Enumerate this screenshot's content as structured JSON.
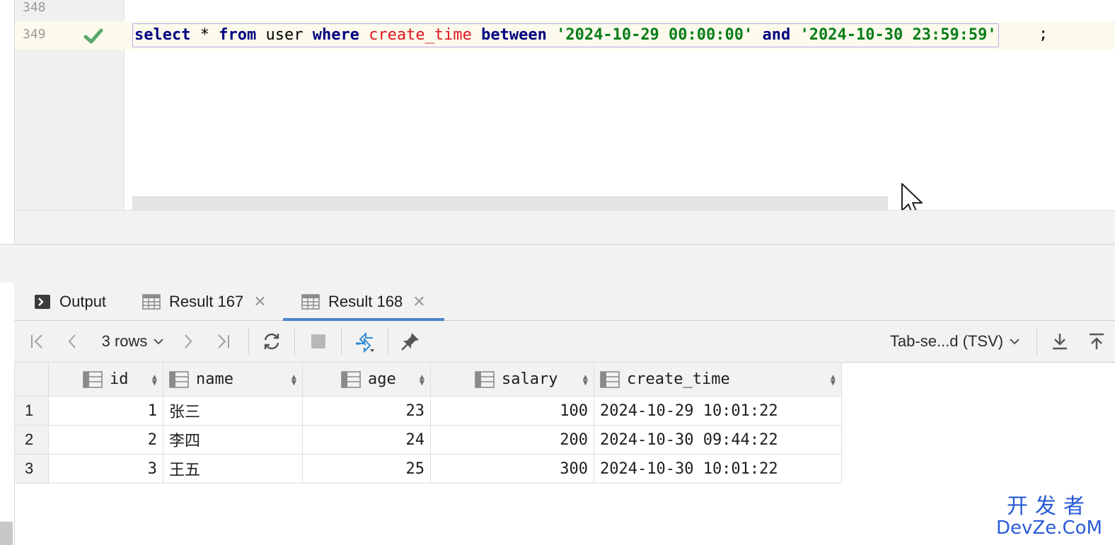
{
  "editor": {
    "lines": [
      {
        "number": "348"
      },
      {
        "number": "349"
      }
    ],
    "code": {
      "kw_select": "select",
      "star": " * ",
      "kw_from": "from",
      "table": " user ",
      "kw_where": "where",
      "sp1": " ",
      "field": "create_time",
      "sp2": " ",
      "kw_between": "between",
      "sp3": " ",
      "start": "'2024-10-29 00:00:00'",
      "sp4": " ",
      "kw_and": "and",
      "sp5": " ",
      "end": "'2024-10-30 23:59:59'",
      "semicolon": ";"
    }
  },
  "tabs": [
    {
      "label": "Output",
      "icon": "console-icon"
    },
    {
      "label": "Result 167",
      "icon": "table-icon",
      "close": "✕"
    },
    {
      "label": "Result 168",
      "icon": "table-icon",
      "close": "✕",
      "active": true
    }
  ],
  "toolbar": {
    "rows_label": "3 rows",
    "format_label": "Tab-se...d (TSV)"
  },
  "grid": {
    "columns": [
      "id",
      "name",
      "age",
      "salary",
      "create_time"
    ],
    "rows": [
      {
        "rownum": "1",
        "id": "1",
        "name": "张三",
        "age": "23",
        "salary": "100",
        "create_time": "2024-10-29 10:01:22"
      },
      {
        "rownum": "2",
        "id": "2",
        "name": "李四",
        "age": "24",
        "salary": "200",
        "create_time": "2024-10-30 09:44:22"
      },
      {
        "rownum": "3",
        "id": "3",
        "name": "王五",
        "age": "25",
        "salary": "300",
        "create_time": "2024-10-30 10:01:22"
      }
    ]
  },
  "watermark": {
    "cn": "开发者",
    "en": "DevZe.CoM"
  },
  "colors": {
    "keyword": "#000080",
    "field": "#e0141e",
    "string": "#067d17",
    "active_tab": "#4a86c8",
    "check": "#59a869"
  }
}
